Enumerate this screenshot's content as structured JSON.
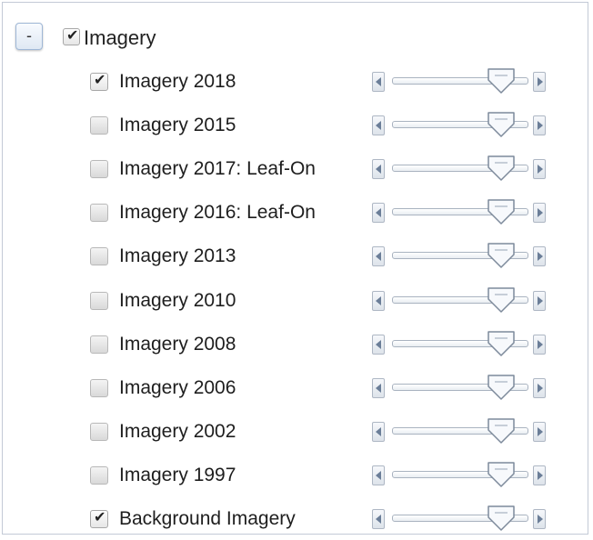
{
  "group": {
    "collapse_label": "-",
    "label": "Imagery",
    "checked": true
  },
  "layers": [
    {
      "label": "Imagery 2018",
      "checked": true,
      "opacity": 0.8
    },
    {
      "label": "Imagery 2015",
      "checked": false,
      "opacity": 0.8
    },
    {
      "label": "Imagery 2017: Leaf-On",
      "checked": false,
      "opacity": 0.8
    },
    {
      "label": "Imagery 2016: Leaf-On",
      "checked": false,
      "opacity": 0.8
    },
    {
      "label": "Imagery 2013",
      "checked": false,
      "opacity": 0.8
    },
    {
      "label": "Imagery 2010",
      "checked": false,
      "opacity": 0.8
    },
    {
      "label": "Imagery 2008",
      "checked": false,
      "opacity": 0.8
    },
    {
      "label": "Imagery 2006",
      "checked": false,
      "opacity": 0.8
    },
    {
      "label": "Imagery 2002",
      "checked": false,
      "opacity": 0.8
    },
    {
      "label": "Imagery 1997",
      "checked": false,
      "opacity": 0.8
    },
    {
      "label": "Background Imagery",
      "checked": true,
      "opacity": 0.8
    }
  ],
  "icons": {
    "checkbox_checked": "check-icon",
    "slider_left": "arrow-left-icon",
    "slider_right": "arrow-right-icon",
    "slider_thumb": "slider-thumb-icon"
  }
}
